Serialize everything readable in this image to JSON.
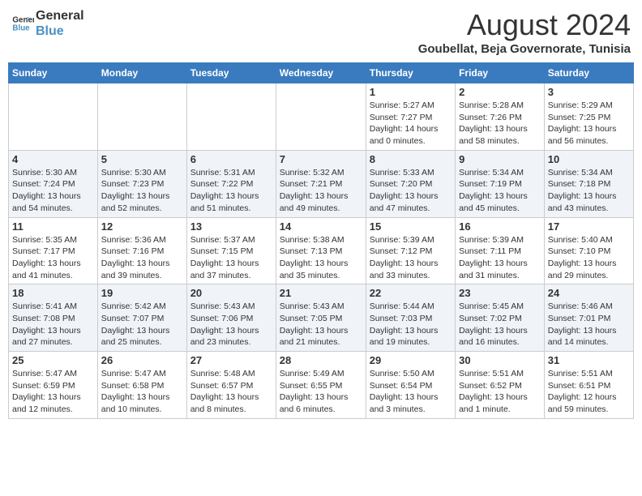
{
  "header": {
    "logo_line1": "General",
    "logo_line2": "Blue",
    "month_year": "August 2024",
    "location": "Goubellat, Beja Governorate, Tunisia"
  },
  "weekdays": [
    "Sunday",
    "Monday",
    "Tuesday",
    "Wednesday",
    "Thursday",
    "Friday",
    "Saturday"
  ],
  "weeks": [
    {
      "days": [
        {
          "num": "",
          "info": ""
        },
        {
          "num": "",
          "info": ""
        },
        {
          "num": "",
          "info": ""
        },
        {
          "num": "",
          "info": ""
        },
        {
          "num": "1",
          "info": "Sunrise: 5:27 AM\nSunset: 7:27 PM\nDaylight: 14 hours\nand 0 minutes."
        },
        {
          "num": "2",
          "info": "Sunrise: 5:28 AM\nSunset: 7:26 PM\nDaylight: 13 hours\nand 58 minutes."
        },
        {
          "num": "3",
          "info": "Sunrise: 5:29 AM\nSunset: 7:25 PM\nDaylight: 13 hours\nand 56 minutes."
        }
      ]
    },
    {
      "days": [
        {
          "num": "4",
          "info": "Sunrise: 5:30 AM\nSunset: 7:24 PM\nDaylight: 13 hours\nand 54 minutes."
        },
        {
          "num": "5",
          "info": "Sunrise: 5:30 AM\nSunset: 7:23 PM\nDaylight: 13 hours\nand 52 minutes."
        },
        {
          "num": "6",
          "info": "Sunrise: 5:31 AM\nSunset: 7:22 PM\nDaylight: 13 hours\nand 51 minutes."
        },
        {
          "num": "7",
          "info": "Sunrise: 5:32 AM\nSunset: 7:21 PM\nDaylight: 13 hours\nand 49 minutes."
        },
        {
          "num": "8",
          "info": "Sunrise: 5:33 AM\nSunset: 7:20 PM\nDaylight: 13 hours\nand 47 minutes."
        },
        {
          "num": "9",
          "info": "Sunrise: 5:34 AM\nSunset: 7:19 PM\nDaylight: 13 hours\nand 45 minutes."
        },
        {
          "num": "10",
          "info": "Sunrise: 5:34 AM\nSunset: 7:18 PM\nDaylight: 13 hours\nand 43 minutes."
        }
      ]
    },
    {
      "days": [
        {
          "num": "11",
          "info": "Sunrise: 5:35 AM\nSunset: 7:17 PM\nDaylight: 13 hours\nand 41 minutes."
        },
        {
          "num": "12",
          "info": "Sunrise: 5:36 AM\nSunset: 7:16 PM\nDaylight: 13 hours\nand 39 minutes."
        },
        {
          "num": "13",
          "info": "Sunrise: 5:37 AM\nSunset: 7:15 PM\nDaylight: 13 hours\nand 37 minutes."
        },
        {
          "num": "14",
          "info": "Sunrise: 5:38 AM\nSunset: 7:13 PM\nDaylight: 13 hours\nand 35 minutes."
        },
        {
          "num": "15",
          "info": "Sunrise: 5:39 AM\nSunset: 7:12 PM\nDaylight: 13 hours\nand 33 minutes."
        },
        {
          "num": "16",
          "info": "Sunrise: 5:39 AM\nSunset: 7:11 PM\nDaylight: 13 hours\nand 31 minutes."
        },
        {
          "num": "17",
          "info": "Sunrise: 5:40 AM\nSunset: 7:10 PM\nDaylight: 13 hours\nand 29 minutes."
        }
      ]
    },
    {
      "days": [
        {
          "num": "18",
          "info": "Sunrise: 5:41 AM\nSunset: 7:08 PM\nDaylight: 13 hours\nand 27 minutes."
        },
        {
          "num": "19",
          "info": "Sunrise: 5:42 AM\nSunset: 7:07 PM\nDaylight: 13 hours\nand 25 minutes."
        },
        {
          "num": "20",
          "info": "Sunrise: 5:43 AM\nSunset: 7:06 PM\nDaylight: 13 hours\nand 23 minutes."
        },
        {
          "num": "21",
          "info": "Sunrise: 5:43 AM\nSunset: 7:05 PM\nDaylight: 13 hours\nand 21 minutes."
        },
        {
          "num": "22",
          "info": "Sunrise: 5:44 AM\nSunset: 7:03 PM\nDaylight: 13 hours\nand 19 minutes."
        },
        {
          "num": "23",
          "info": "Sunrise: 5:45 AM\nSunset: 7:02 PM\nDaylight: 13 hours\nand 16 minutes."
        },
        {
          "num": "24",
          "info": "Sunrise: 5:46 AM\nSunset: 7:01 PM\nDaylight: 13 hours\nand 14 minutes."
        }
      ]
    },
    {
      "days": [
        {
          "num": "25",
          "info": "Sunrise: 5:47 AM\nSunset: 6:59 PM\nDaylight: 13 hours\nand 12 minutes."
        },
        {
          "num": "26",
          "info": "Sunrise: 5:47 AM\nSunset: 6:58 PM\nDaylight: 13 hours\nand 10 minutes."
        },
        {
          "num": "27",
          "info": "Sunrise: 5:48 AM\nSunset: 6:57 PM\nDaylight: 13 hours\nand 8 minutes."
        },
        {
          "num": "28",
          "info": "Sunrise: 5:49 AM\nSunset: 6:55 PM\nDaylight: 13 hours\nand 6 minutes."
        },
        {
          "num": "29",
          "info": "Sunrise: 5:50 AM\nSunset: 6:54 PM\nDaylight: 13 hours\nand 3 minutes."
        },
        {
          "num": "30",
          "info": "Sunrise: 5:51 AM\nSunset: 6:52 PM\nDaylight: 13 hours\nand 1 minute."
        },
        {
          "num": "31",
          "info": "Sunrise: 5:51 AM\nSunset: 6:51 PM\nDaylight: 12 hours\nand 59 minutes."
        }
      ]
    }
  ]
}
